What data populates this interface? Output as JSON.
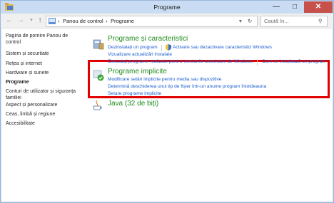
{
  "window": {
    "title": "Programe"
  },
  "titlebar": {
    "minimize": "—",
    "maximize": "□",
    "close": "✕"
  },
  "address": {
    "crumb_root": "Panou de control",
    "crumb_current": "Programe",
    "separator": "›",
    "search_placeholder": "Caută în..."
  },
  "sidebar": {
    "items": [
      {
        "label": "Pagina de pornire Panou de control"
      },
      {
        "label": "Sistem și securitate"
      },
      {
        "label": "Rețea și internet"
      },
      {
        "label": "Hardware și sunete"
      },
      {
        "label": "Programe",
        "current": true
      },
      {
        "label": "Conturi de utilizator și siguranța familiei"
      },
      {
        "label": "Aspect și personalizare"
      },
      {
        "label": "Ceas, limbă și regiune"
      },
      {
        "label": "Accesibilitate"
      }
    ]
  },
  "categories": [
    {
      "title": "Programe și caracteristici",
      "links": [
        "Dezinstalați un program",
        "Activare sau dezactivare caracteristici Windows",
        "Vizualizare actualizări instalate",
        "Executați programe realizate pentru versiunile anterioare de Windows",
        "Cum se instalează un program"
      ]
    },
    {
      "title": "Programe implicite",
      "links": [
        "Modificare setări implicite pentru media sau dispozitive",
        "Determină deschiderea unui tip de fișier într-un anume program întotdeauna",
        "Setare programe implicite"
      ]
    },
    {
      "title": "Java (32 de biți)",
      "links": []
    }
  ],
  "colors": {
    "highlight_box": "#e00000",
    "link": "#1a5ccf",
    "category_title": "#1e8c1e"
  }
}
